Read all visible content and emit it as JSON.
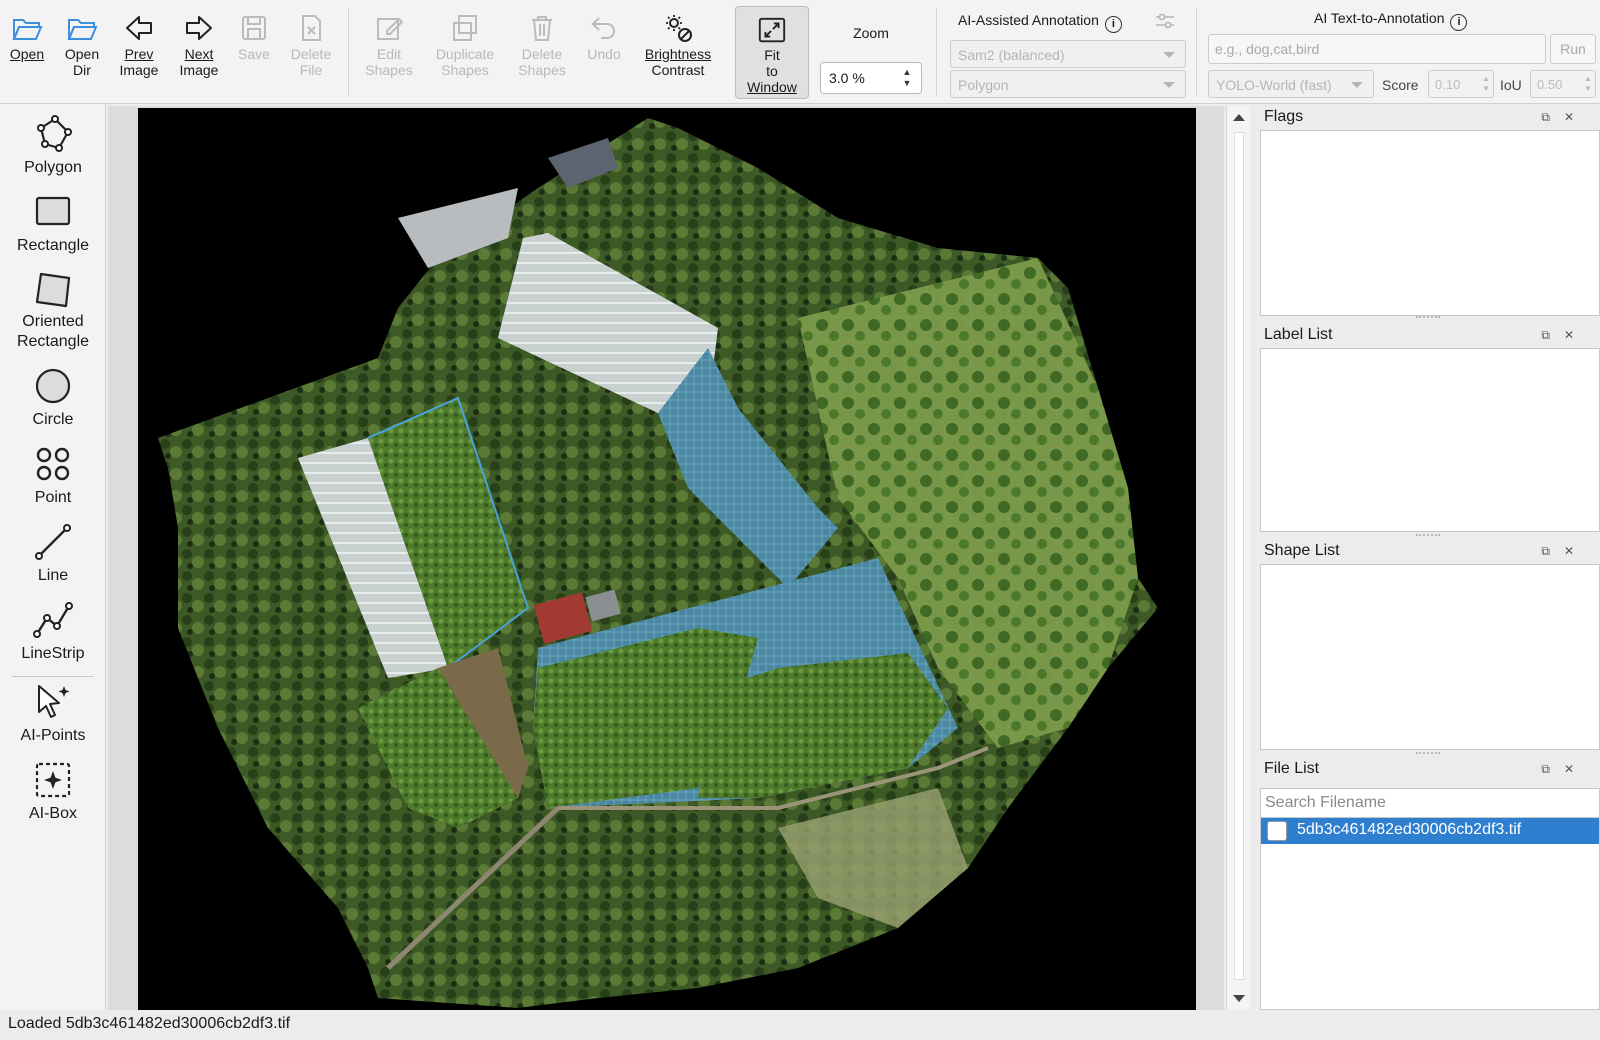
{
  "toolbar": {
    "open": "Open",
    "open_dir": "Open\nDir",
    "prev_image_l1": "Prev",
    "prev_image_l2": "Image",
    "next_image_l1": "Next",
    "next_image_l2": "Image",
    "save": "Save",
    "delete_file": "Delete\nFile",
    "edit_shapes": "Edit\nShapes",
    "duplicate_shapes": "Duplicate\nShapes",
    "delete_shapes": "Delete\nShapes",
    "undo": "Undo",
    "brightness_l1": "Brightness",
    "brightness_l2": "Contrast",
    "fit_l1": "Fit",
    "fit_l2": "to",
    "fit_l3": "Window",
    "zoom_label": "Zoom",
    "zoom_value": "3.0 %"
  },
  "ai_assisted": {
    "title": "AI-Assisted Annotation",
    "model": "Sam2 (balanced)",
    "shape_type": "Polygon"
  },
  "ai_text": {
    "title": "AI Text-to-Annotation",
    "prompt_placeholder": "e.g., dog,cat,bird",
    "run": "Run",
    "model": "YOLO-World (fast)",
    "score_label": "Score",
    "score_value": "0.10",
    "iou_label": "IoU",
    "iou_value": "0.50"
  },
  "tools": {
    "polygon": "Polygon",
    "rectangle": "Rectangle",
    "oriented_rectangle": "Oriented\nRectangle",
    "circle": "Circle",
    "point": "Point",
    "line": "Line",
    "linestrip": "LineStrip",
    "ai_points": "AI-Points",
    "ai_box": "AI-Box"
  },
  "docks": {
    "flags": "Flags",
    "label_list": "Label List",
    "shape_list": "Shape List",
    "file_list": "File List",
    "search_placeholder": "Search Filename",
    "files": [
      "5db3c461482ed30006cb2df3.tif"
    ]
  },
  "status": "Loaded 5db3c461482ed30006cb2df3.tif",
  "colors": {
    "accent": "#2f7fd1",
    "folder_icon": "#3d8fe0"
  }
}
